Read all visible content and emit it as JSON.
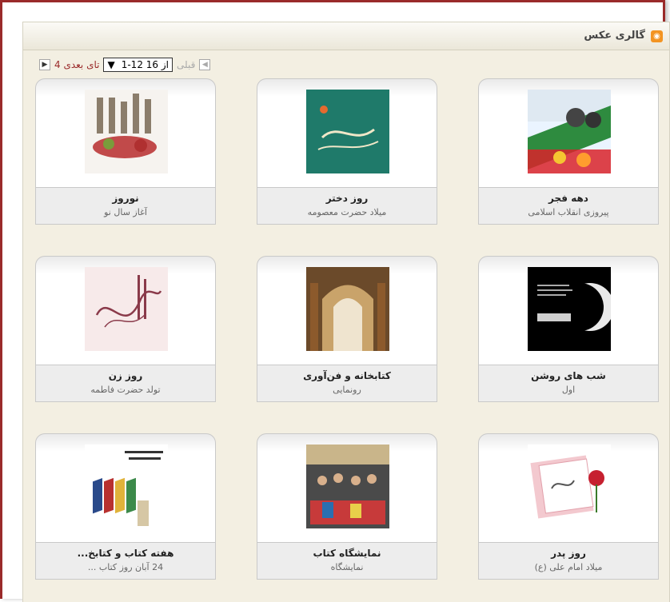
{
  "gallery": {
    "title": "گالری عکس"
  },
  "pager": {
    "next_label": "4 تای بعدی",
    "range": "1-12 از 16",
    "prev_label": "قبلی"
  },
  "items": [
    {
      "title": "دهه فجر",
      "subtitle": "پیروزی انقلاب اسلامی"
    },
    {
      "title": "روز دختر",
      "subtitle": "میلاد حضرت معصومه"
    },
    {
      "title": "نوروز",
      "subtitle": "آغاز سال نو"
    },
    {
      "title": "شب های روشن",
      "subtitle": "اول"
    },
    {
      "title": "کتابخانه و فن‌آوری",
      "subtitle": "رونمایی"
    },
    {
      "title": "روز زن",
      "subtitle": "تولد حضرت فاطمه"
    },
    {
      "title": "روز پدر",
      "subtitle": "میلاد امام علی (ع)"
    },
    {
      "title": "نمایشگاه کتاب",
      "subtitle": "نمایشگاه"
    },
    {
      "title": "هفته کتاب و کتابخ...",
      "subtitle": "24 آبان روز کتاب ..."
    }
  ]
}
